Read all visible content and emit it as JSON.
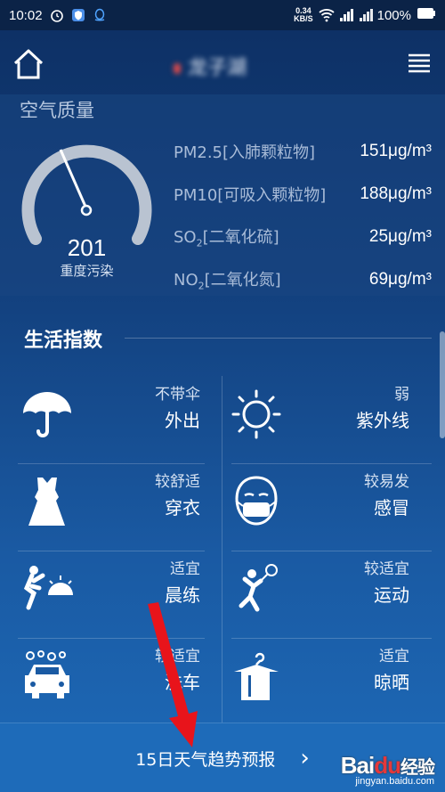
{
  "status_bar": {
    "time": "10:02",
    "net_speed_value": "0.34",
    "net_speed_unit": "KB/S",
    "battery": "100%"
  },
  "header": {
    "city": "龙子湖"
  },
  "air_quality": {
    "title": "空气质量",
    "aqi": "201",
    "level": "重度污染",
    "pollutants": [
      {
        "name": "PM2.5[入肺颗粒物]",
        "value": "151μg/m³"
      },
      {
        "name": "PM10[可吸入颗粒物]",
        "value": "188μg/m³"
      },
      {
        "name_main": "SO",
        "name_sub": "2",
        "name_rest": "[二氧化硫]",
        "value": "25μg/m³"
      },
      {
        "name_main": "NO",
        "name_sub": "2",
        "name_rest": "[二氧化氮]",
        "value": "69μg/m³"
      }
    ]
  },
  "life_index": {
    "title": "生活指数",
    "items": [
      {
        "icon": "umbrella-icon",
        "level": "不带伞",
        "category": "外出"
      },
      {
        "icon": "sun-icon",
        "level": "弱",
        "category": "紫外线"
      },
      {
        "icon": "dress-icon",
        "level": "较舒适",
        "category": "穿衣"
      },
      {
        "icon": "mask-icon",
        "level": "较易发",
        "category": "感冒"
      },
      {
        "icon": "morning-exercise-icon",
        "level": "适宜",
        "category": "晨练"
      },
      {
        "icon": "sport-icon",
        "level": "较适宜",
        "category": "运动"
      },
      {
        "icon": "car-wash-icon",
        "level": "较适宜",
        "category": "洗车"
      },
      {
        "icon": "hanger-icon",
        "level": "适宜",
        "category": "晾晒"
      }
    ]
  },
  "bottom": {
    "forecast_label": "15日天气趋势预报",
    "chevron": "›"
  },
  "watermark": {
    "logo_a": "Bai",
    "logo_b": "du",
    "logo_c": "经验",
    "url": "jingyan.baidu.com"
  },
  "colors": {
    "background_top": "#0d2f63",
    "background_bottom": "#1d6ab8",
    "gauge_track": "#b9c3d1",
    "annotation_arrow": "#e8141b"
  }
}
